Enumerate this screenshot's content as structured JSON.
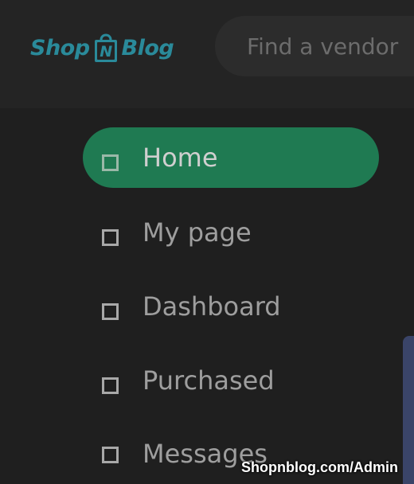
{
  "header": {
    "logo": {
      "left_text": "Shop",
      "mid_text": "N",
      "right_text": "Blog",
      "color": "#2a8a9a"
    },
    "search": {
      "placeholder": "Find a vendor"
    }
  },
  "nav": {
    "items": [
      {
        "label": "Home",
        "icon": "square-icon",
        "active": true
      },
      {
        "label": "My page",
        "icon": "square-icon",
        "active": false
      },
      {
        "label": "Dashboard",
        "icon": "square-icon",
        "active": false
      },
      {
        "label": "Purchased",
        "icon": "square-icon",
        "active": false
      },
      {
        "label": "Messages",
        "icon": "square-icon",
        "active": false
      }
    ],
    "active_color": "#1f7a52"
  },
  "watermark": {
    "text": "Shopnblog.com/Admin"
  }
}
